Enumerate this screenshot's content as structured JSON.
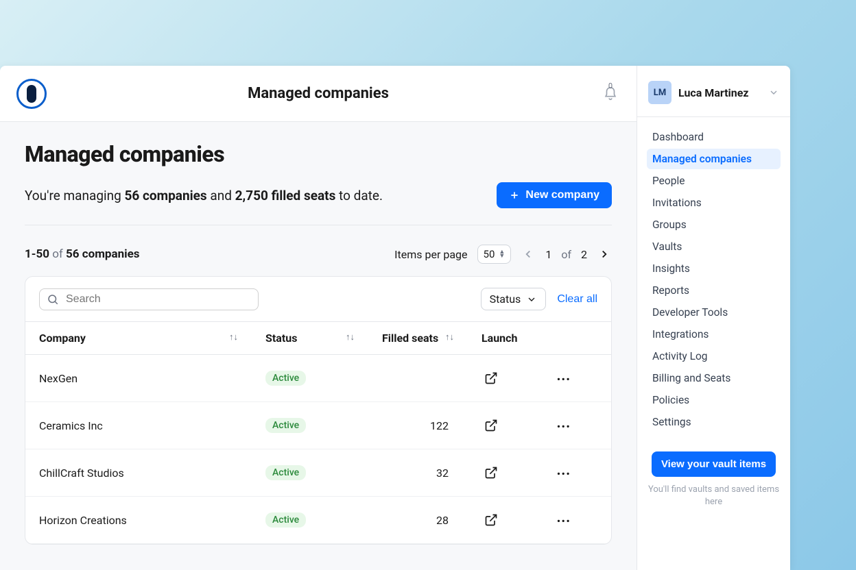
{
  "header": {
    "title": "Managed companies",
    "notifications_count": "0"
  },
  "page": {
    "title": "Managed companies",
    "summary_prefix": "You're managing ",
    "summary_companies": "56 companies",
    "summary_mid": " and ",
    "summary_seats": "2,750 filled seats",
    "summary_suffix": " to date.",
    "new_company_label": "New company"
  },
  "pager": {
    "range": "1-50",
    "of_label": "of",
    "total": "56 companies",
    "ipp_label": "Items per page",
    "ipp_value": "50",
    "current_page": "1",
    "page_of": "of",
    "total_pages": "2"
  },
  "filters": {
    "search_placeholder": "Search",
    "status_label": "Status",
    "clear_all": "Clear all"
  },
  "table": {
    "columns": {
      "company": "Company",
      "status": "Status",
      "filled_seats": "Filled seats",
      "launch": "Launch"
    },
    "status_active": "Active",
    "rows": [
      {
        "company": "NexGen",
        "status": "Active",
        "seats": ""
      },
      {
        "company": "Ceramics Inc",
        "status": "Active",
        "seats": "122"
      },
      {
        "company": "ChillCraft Studios",
        "status": "Active",
        "seats": "32"
      },
      {
        "company": "Horizon Creations",
        "status": "Active",
        "seats": "28"
      }
    ]
  },
  "sidebar": {
    "user_initials": "LM",
    "user_name": "Luca Martinez",
    "nav": [
      "Dashboard",
      "Managed companies",
      "People",
      "Invitations",
      "Groups",
      "Vaults",
      "Insights",
      "Reports",
      "Developer Tools",
      "Integrations",
      "Activity Log",
      "Billing and Seats",
      "Policies",
      "Settings"
    ],
    "active_nav_index": 1,
    "vault_button": "View your vault items",
    "vault_hint": "You'll find vaults and saved items here"
  }
}
